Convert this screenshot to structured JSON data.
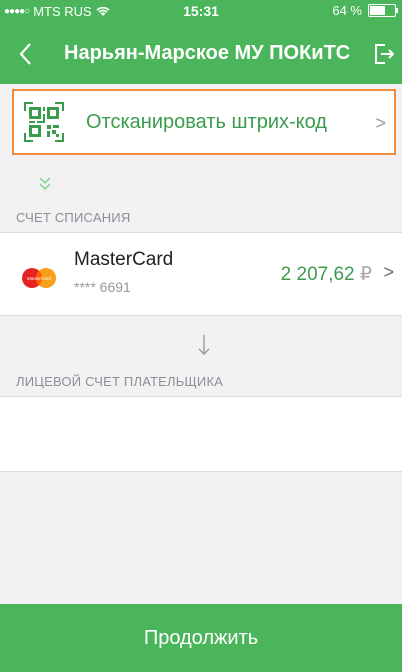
{
  "status_bar": {
    "carrier": "MTS RUS",
    "time": "15:31",
    "battery_percent": "64 %",
    "battery_level": 0.64
  },
  "navbar": {
    "title": "Нарьян-Марское МУ ПОКиТС"
  },
  "scan": {
    "label": "Отсканировать штрих-код",
    "chevron": ">"
  },
  "debit_section": {
    "label": "СЧЕТ СПИСАНИЯ",
    "card": {
      "brand_label": "MasterCard",
      "name": "MasterCard",
      "masked_number": "**** 6691",
      "amount": "2 207,62",
      "currency": "₽",
      "chevron": ">"
    }
  },
  "payer_section": {
    "label": "ЛИЦЕВОЙ СЧЕТ ПЛАТЕЛЬЩИКА",
    "value": ""
  },
  "footer": {
    "continue_label": "Продолжить"
  },
  "colors": {
    "brand_green": "#4ab55a",
    "accent_text_green": "#3b9c4e",
    "highlight_orange": "#f08c3c",
    "background": "#f2f2f4"
  }
}
